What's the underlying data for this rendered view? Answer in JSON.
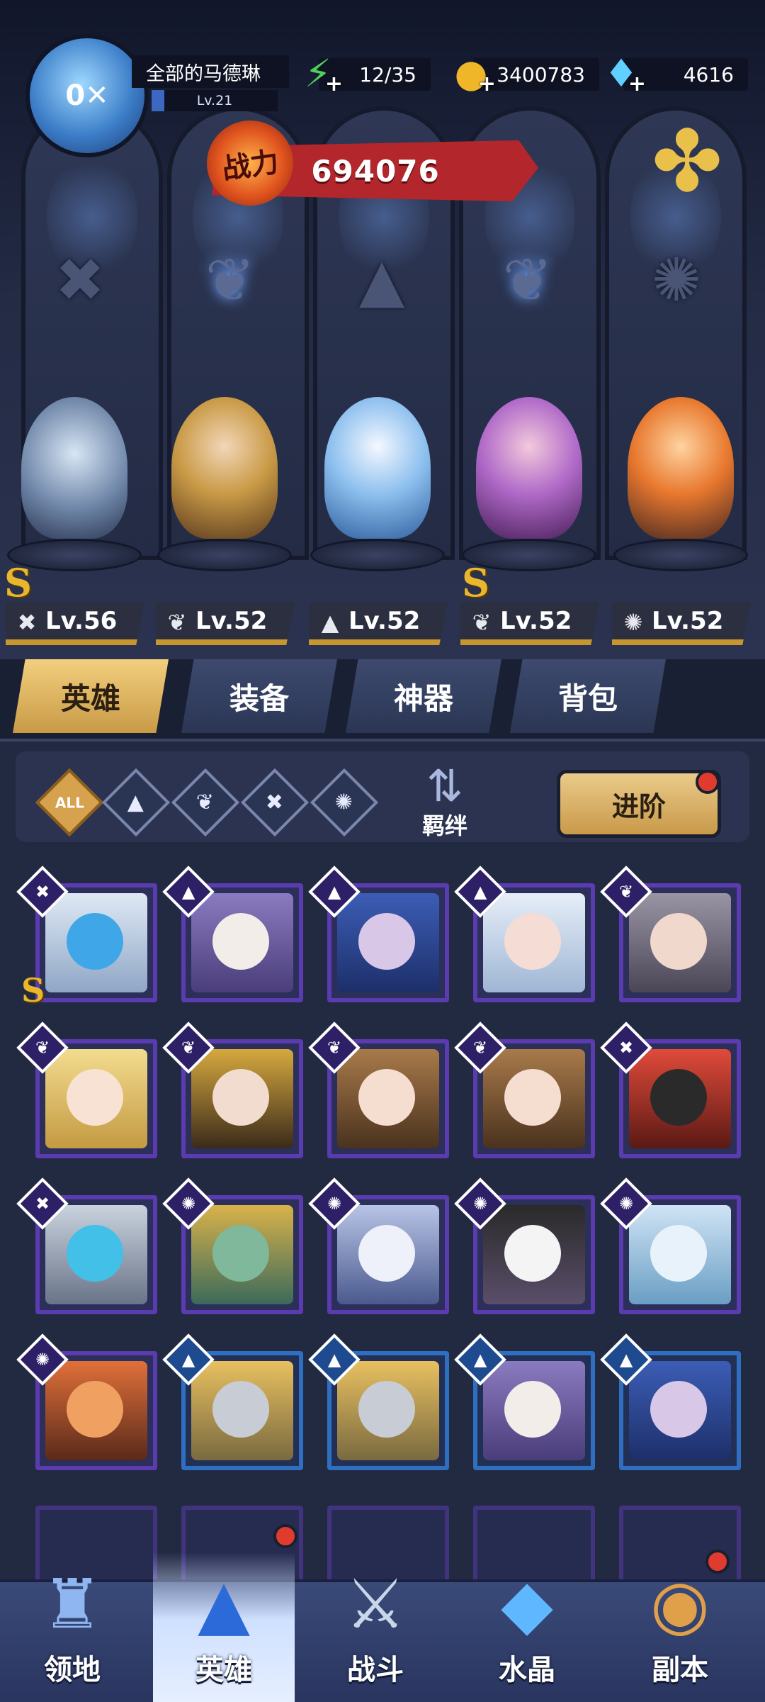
{
  "player": {
    "name": "全部的马德琳",
    "level": "Lv.21",
    "avatar_text": "0✕"
  },
  "resources": {
    "stamina": "12/35",
    "gold": "3400783",
    "gems": "4616"
  },
  "power": {
    "badge": "战力",
    "value": "694076"
  },
  "lineup": [
    {
      "level": "Lv.56",
      "class_icon": "wrench-icon",
      "rank": "S"
    },
    {
      "level": "Lv.52",
      "class_icon": "wing-icon",
      "rank": ""
    },
    {
      "level": "Lv.52",
      "class_icon": "hat-icon",
      "rank": ""
    },
    {
      "level": "Lv.52",
      "class_icon": "wing-icon",
      "rank": "S"
    },
    {
      "level": "Lv.52",
      "class_icon": "beast-icon",
      "rank": ""
    }
  ],
  "tabs": [
    "英雄",
    "装备",
    "神器",
    "背包"
  ],
  "filters": {
    "all": "ALL",
    "bond_label": "羁绊",
    "advance": "进阶"
  },
  "nav": [
    "领地",
    "英雄",
    "战斗",
    "水晶",
    "副本"
  ],
  "colors": {
    "purple_frame": "#5b3bb0",
    "blue_frame": "#2f6fc2",
    "gold": "#c99a46",
    "alert": "#e03b2f"
  }
}
